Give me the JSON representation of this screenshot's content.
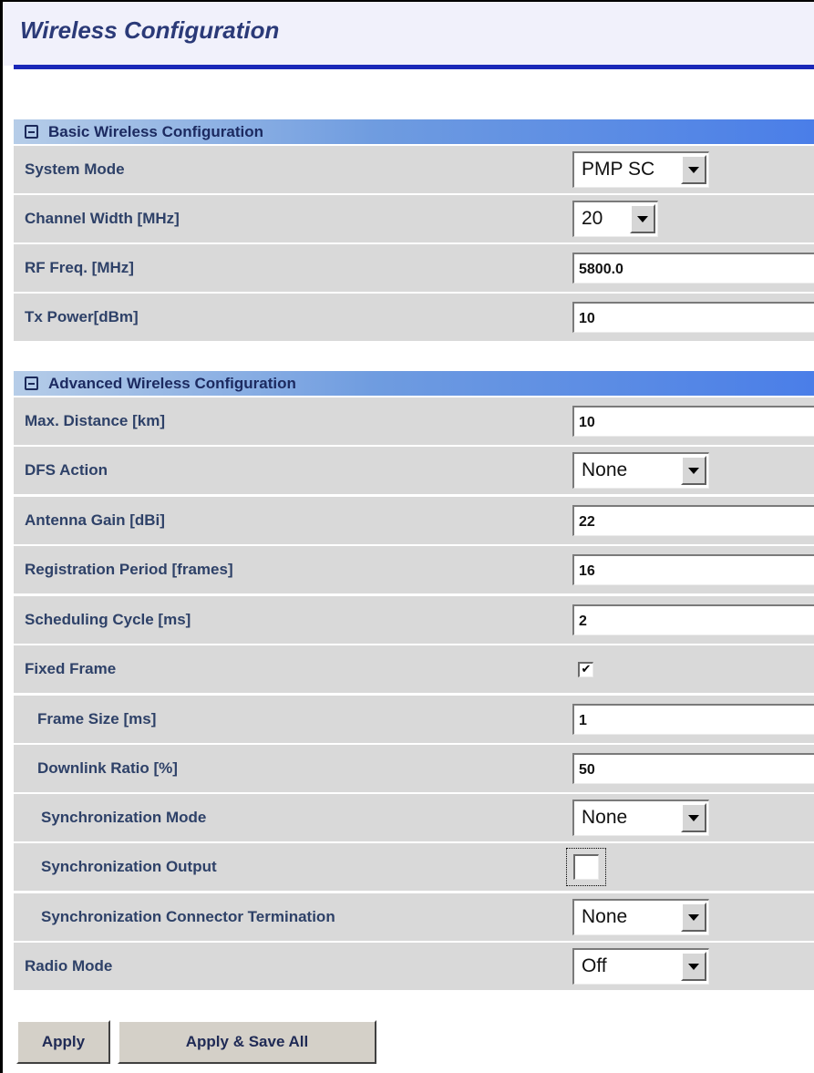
{
  "page": {
    "title": "Wireless Configuration"
  },
  "basic": {
    "title": "Basic Wireless Configuration",
    "system_mode": {
      "label": "System Mode",
      "value": "PMP SC"
    },
    "channel_width": {
      "label": "Channel Width [MHz]",
      "value": "20"
    },
    "rf_freq": {
      "label": "RF Freq. [MHz]",
      "value": "5800.0"
    },
    "tx_power": {
      "label": "Tx Power[dBm]",
      "value": "10"
    }
  },
  "advanced": {
    "title": "Advanced Wireless Configuration",
    "max_distance": {
      "label": "Max. Distance [km]",
      "value": "10"
    },
    "dfs_action": {
      "label": "DFS Action",
      "value": "None"
    },
    "antenna_gain": {
      "label": "Antenna Gain [dBi]",
      "value": "22"
    },
    "registration_period": {
      "label": "Registration Period [frames]",
      "value": "16"
    },
    "scheduling_cycle": {
      "label": "Scheduling Cycle [ms]",
      "value": "2"
    },
    "fixed_frame": {
      "label": "Fixed Frame",
      "checked": true
    },
    "frame_size": {
      "label": "Frame Size [ms]",
      "value": "1"
    },
    "downlink_ratio": {
      "label": "Downlink Ratio [%]",
      "value": "50"
    },
    "sync_mode": {
      "label": "Synchronization Mode",
      "value": "None"
    },
    "sync_output": {
      "label": "Synchronization Output",
      "checked": false
    },
    "sync_termination": {
      "label": "Synchronization Connector Termination",
      "value": "None"
    },
    "radio_mode": {
      "label": "Radio Mode",
      "value": "Off"
    }
  },
  "buttons": {
    "apply": "Apply",
    "apply_save_all": "Apply & Save All"
  },
  "icons": {
    "collapse": "collapse-minus-icon",
    "dropdown": "chevron-down-icon",
    "check": "✔"
  },
  "colors": {
    "accent": "#1a28b8",
    "label": "#2e4168",
    "row_bg": "#d9d9d9",
    "title": "#2b3a78"
  }
}
